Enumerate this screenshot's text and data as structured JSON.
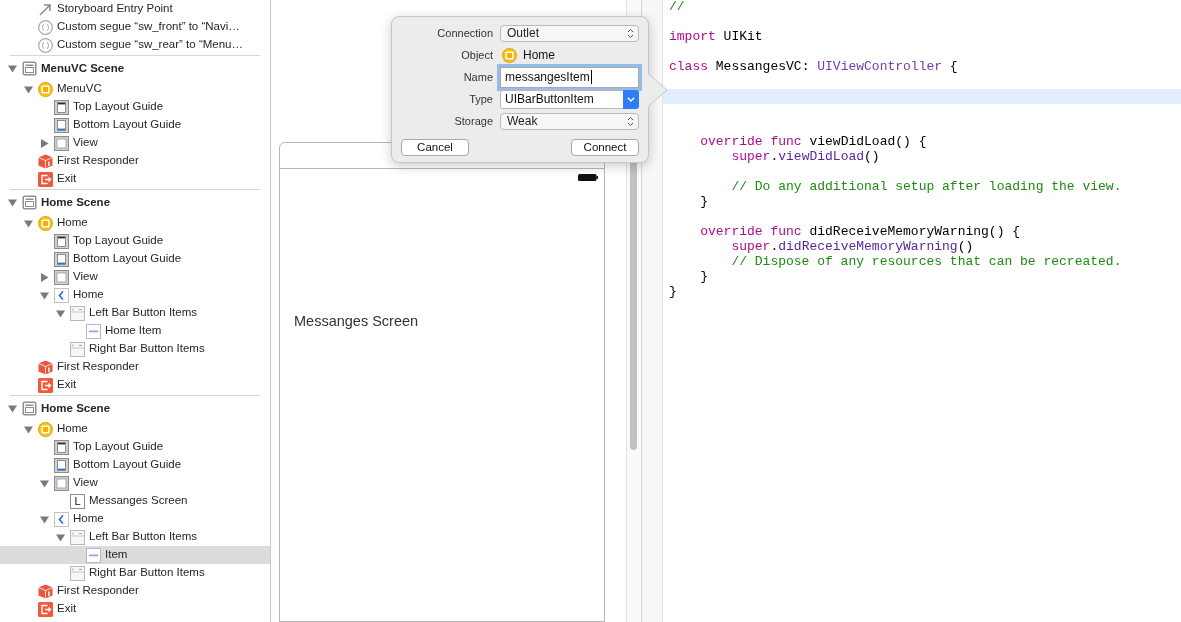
{
  "outline": {
    "partial_scene_items": [
      {
        "kind": "entry",
        "label": "Storyboard Entry Point",
        "selected": false
      },
      {
        "kind": "segue",
        "label": "Custom segue “sw_front” to “Navi…",
        "selected": false
      },
      {
        "kind": "segue",
        "label": "Custom segue “sw_rear” to “Menu…",
        "selected": false
      }
    ],
    "scenes": [
      {
        "label": "MenuVC Scene",
        "expanded": true,
        "selected": false,
        "children": [
          {
            "kind": "controller",
            "label": "MenuVC",
            "expanded": true,
            "selected": false,
            "children": [
              {
                "kind": "guide-top",
                "label": "Top Layout Guide",
                "selected": false
              },
              {
                "kind": "guide-bottom",
                "label": "Bottom Layout Guide",
                "selected": false
              },
              {
                "kind": "view",
                "label": "View",
                "expanded": false,
                "selected": false
              }
            ]
          },
          {
            "kind": "responder",
            "label": "First Responder",
            "selected": false
          },
          {
            "kind": "exit",
            "label": "Exit",
            "selected": false
          }
        ]
      },
      {
        "label": "Home Scene",
        "expanded": true,
        "selected": false,
        "children": [
          {
            "kind": "controller",
            "label": "Home",
            "expanded": true,
            "selected": false,
            "children": [
              {
                "kind": "guide-top",
                "label": "Top Layout Guide",
                "selected": false
              },
              {
                "kind": "guide-bottom",
                "label": "Bottom Layout Guide",
                "selected": false
              },
              {
                "kind": "view",
                "label": "View",
                "expanded": false,
                "selected": false
              },
              {
                "kind": "nav-item",
                "label": "Home",
                "expanded": true,
                "selected": false,
                "children": [
                  {
                    "kind": "bar-items",
                    "label": "Left Bar Button Items",
                    "expanded": true,
                    "selected": false,
                    "children": [
                      {
                        "kind": "bar-button",
                        "label": "Home Item",
                        "selected": false
                      }
                    ]
                  },
                  {
                    "kind": "bar-items",
                    "label": "Right Bar Button Items",
                    "selected": false
                  }
                ]
              }
            ]
          },
          {
            "kind": "responder",
            "label": "First Responder",
            "selected": false
          },
          {
            "kind": "exit",
            "label": "Exit",
            "selected": false
          }
        ]
      },
      {
        "label": "Home Scene",
        "expanded": true,
        "selected": false,
        "children": [
          {
            "kind": "controller",
            "label": "Home",
            "expanded": true,
            "selected": false,
            "children": [
              {
                "kind": "guide-top",
                "label": "Top Layout Guide",
                "selected": false
              },
              {
                "kind": "guide-bottom",
                "label": "Bottom Layout Guide",
                "selected": false
              },
              {
                "kind": "view",
                "label": "View",
                "expanded": true,
                "selected": false,
                "children": [
                  {
                    "kind": "label",
                    "icon_glyph": "L",
                    "label": "Messanges Screen",
                    "selected": false
                  }
                ]
              },
              {
                "kind": "nav-item",
                "label": "Home",
                "expanded": true,
                "selected": false,
                "children": [
                  {
                    "kind": "bar-items",
                    "label": "Left Bar Button Items",
                    "expanded": true,
                    "selected": false,
                    "children": [
                      {
                        "kind": "bar-button",
                        "label": "Item",
                        "selected": true
                      }
                    ]
                  },
                  {
                    "kind": "bar-items",
                    "label": "Right Bar Button Items",
                    "selected": false
                  }
                ]
              }
            ]
          },
          {
            "kind": "responder",
            "label": "First Responder",
            "selected": false
          },
          {
            "kind": "exit",
            "label": "Exit",
            "selected": false
          }
        ]
      }
    ]
  },
  "canvas": {
    "screen_label": "Messanges Screen"
  },
  "connection_popover": {
    "fields": [
      {
        "label": "Connection",
        "kind": "popup",
        "value": "Outlet",
        "focused": false
      },
      {
        "label": "Object",
        "kind": "object",
        "value": "Home",
        "focused": false
      },
      {
        "label": "Name",
        "kind": "text",
        "value": "messangesItem",
        "focused": true
      },
      {
        "label": "Type",
        "kind": "combo",
        "value": "UIBarButtonItem",
        "focused": false
      },
      {
        "label": "Storage",
        "kind": "popup",
        "value": "Weak",
        "focused": false
      }
    ],
    "buttons": [
      {
        "label": "Cancel"
      },
      {
        "label": "Connect"
      }
    ]
  },
  "editor": {
    "lines": [
      {
        "highlighted": false,
        "tokens": [
          {
            "kind": "comment",
            "text": "//"
          }
        ]
      },
      {
        "highlighted": false
      },
      {
        "highlighted": false,
        "tokens": [
          {
            "kind": "keyword",
            "text": "import"
          },
          {
            "kind": "plain",
            "text": " UIKit"
          }
        ]
      },
      {
        "highlighted": false
      },
      {
        "highlighted": false,
        "tokens": [
          {
            "kind": "keyword",
            "text": "class"
          },
          {
            "kind": "plain",
            "text": " MessangesVC: "
          },
          {
            "kind": "type",
            "text": "UIViewController"
          },
          {
            "kind": "plain",
            "text": " {"
          }
        ],
        "children": [
          {
            "highlighted": false
          },
          {
            "highlighted": true
          },
          {
            "highlighted": false
          },
          {
            "highlighted": false
          },
          {
            "highlighted": false,
            "tokens": [
              {
                "kind": "keyword",
                "text": "override func"
              },
              {
                "kind": "plain",
                "text": " viewDidLoad() {"
              }
            ],
            "children": [
              {
                "highlighted": false,
                "tokens": [
                  {
                    "kind": "keyword",
                    "text": "super"
                  },
                  {
                    "kind": "plain",
                    "text": "."
                  },
                  {
                    "kind": "call",
                    "text": "viewDidLoad"
                  },
                  {
                    "kind": "plain",
                    "text": "()"
                  }
                ]
              },
              {
                "highlighted": false
              },
              {
                "highlighted": false,
                "tokens": [
                  {
                    "kind": "comment",
                    "text": "// Do any additional setup after loading the view."
                  }
                ]
              }
            ]
          },
          {
            "highlighted": false,
            "tokens": [
              {
                "kind": "plain",
                "text": "}"
              }
            ]
          },
          {
            "highlighted": false
          },
          {
            "highlighted": false,
            "tokens": [
              {
                "kind": "keyword",
                "text": "override func"
              },
              {
                "kind": "plain",
                "text": " didReceiveMemoryWarning() {"
              }
            ],
            "children": [
              {
                "highlighted": false,
                "tokens": [
                  {
                    "kind": "keyword",
                    "text": "super"
                  },
                  {
                    "kind": "plain",
                    "text": "."
                  },
                  {
                    "kind": "call",
                    "text": "didReceiveMemoryWarning"
                  },
                  {
                    "kind": "plain",
                    "text": "()"
                  }
                ]
              },
              {
                "highlighted": false,
                "tokens": [
                  {
                    "kind": "comment",
                    "text": "// Dispose of any resources that can be recreated."
                  }
                ]
              }
            ]
          },
          {
            "highlighted": false,
            "tokens": [
              {
                "kind": "plain",
                "text": "}"
              }
            ]
          }
        ]
      },
      {
        "highlighted": false,
        "tokens": [
          {
            "kind": "plain",
            "text": "}"
          }
        ]
      }
    ]
  }
}
